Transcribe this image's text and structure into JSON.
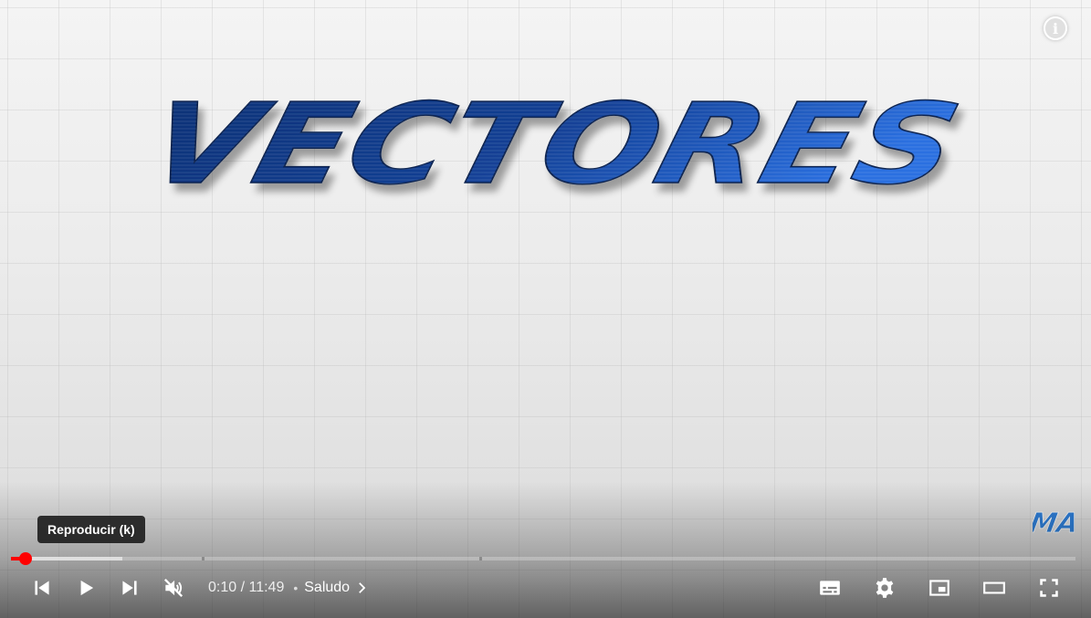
{
  "video": {
    "title_art_text": "VECTORES",
    "watermark_text": "MA"
  },
  "tooltip": {
    "text": "Reproducir (k)"
  },
  "controls": {
    "current_time": "0:10",
    "time_separator": " / ",
    "duration": "11:49",
    "chapter_dot": "•",
    "chapter_name": "Saludo",
    "buttons": {
      "previous": "previous-icon",
      "play": "play-icon",
      "next": "next-icon",
      "mute": "muted-volume-icon",
      "subtitles": "subtitles-icon",
      "settings": "gear-icon",
      "miniplayer": "miniplayer-icon",
      "theater": "theater-mode-icon",
      "fullscreen": "fullscreen-icon"
    }
  },
  "progress": {
    "played_seconds": 10,
    "duration_seconds": 709,
    "buffered_fraction": 0.105,
    "chapters_fraction_starts": [
      0,
      0.179,
      0.44
    ]
  },
  "colors": {
    "accent": "#ff0000",
    "title_blue_dark": "#0b2f73",
    "title_blue_light": "#2a6fe0",
    "watermark": "#2f7fd8"
  }
}
